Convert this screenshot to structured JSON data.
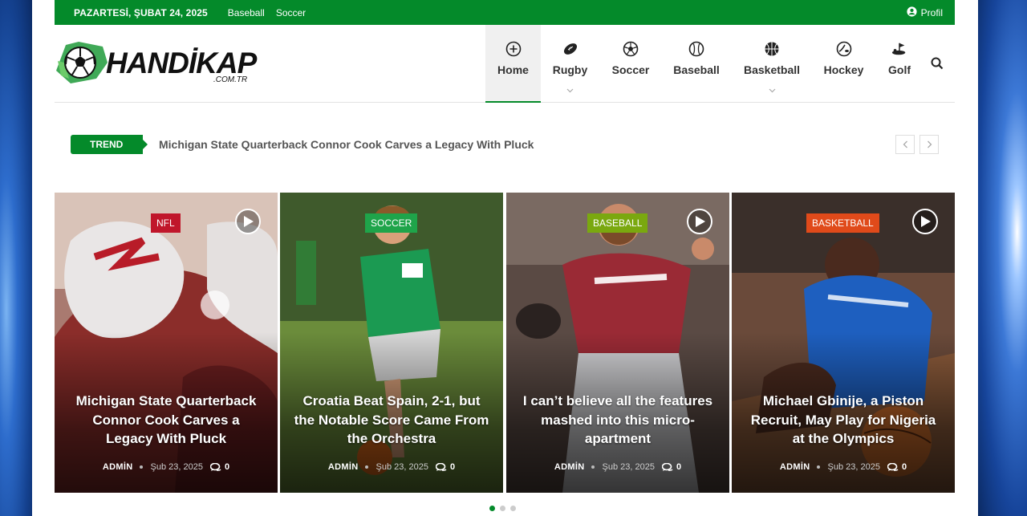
{
  "topbar": {
    "date": "PAZARTESİ, ŞUBAT 24, 2025",
    "links": [
      "Baseball",
      "Soccer"
    ],
    "profile": "Profil"
  },
  "logo": {
    "name": "HANDİKAP",
    "domain": ".COM.TR"
  },
  "nav": [
    {
      "label": "Home",
      "icon": "plus-circle-icon",
      "active": true
    },
    {
      "label": "Rugby",
      "icon": "rugby-ball-icon",
      "dropdown": true
    },
    {
      "label": "Soccer",
      "icon": "soccer-ball-icon"
    },
    {
      "label": "Baseball",
      "icon": "baseball-icon"
    },
    {
      "label": "Basketball",
      "icon": "basketball-icon",
      "dropdown": true
    },
    {
      "label": "Hockey",
      "icon": "hockey-puck-icon"
    },
    {
      "label": "Golf",
      "icon": "golf-icon"
    }
  ],
  "trend": {
    "badge": "TREND",
    "headline": "Michigan State Quarterback Connor Cook Carves a Legacy With Pluck"
  },
  "cards": [
    {
      "category": "NFL",
      "color": "#c0162b",
      "title": "Michigan State Quarterback Connor Cook Carves a Legacy With Pluck",
      "author": "ADMİN",
      "date": "Şub 23, 2025",
      "comments": "0"
    },
    {
      "category": "SOCCER",
      "color": "#1fa44a",
      "title": "Croatia Beat Spain, 2-1, but the Notable Score Came From the Orchestra",
      "author": "ADMİN",
      "date": "Şub 23, 2025",
      "comments": "0"
    },
    {
      "category": "BASEBALL",
      "color": "#7aa80f",
      "title": "I can’t believe all the features mashed into this micro-apartment",
      "author": "ADMİN",
      "date": "Şub 23, 2025",
      "comments": "0"
    },
    {
      "category": "BASKETBALL",
      "color": "#e04a1a",
      "title": "Michael Gbinije, a Piston Recruit, May Play for Nigeria at the Olympics",
      "author": "ADMİN",
      "date": "Şub 23, 2025",
      "comments": "0"
    }
  ],
  "colors": {
    "brand": "#048a2a"
  }
}
